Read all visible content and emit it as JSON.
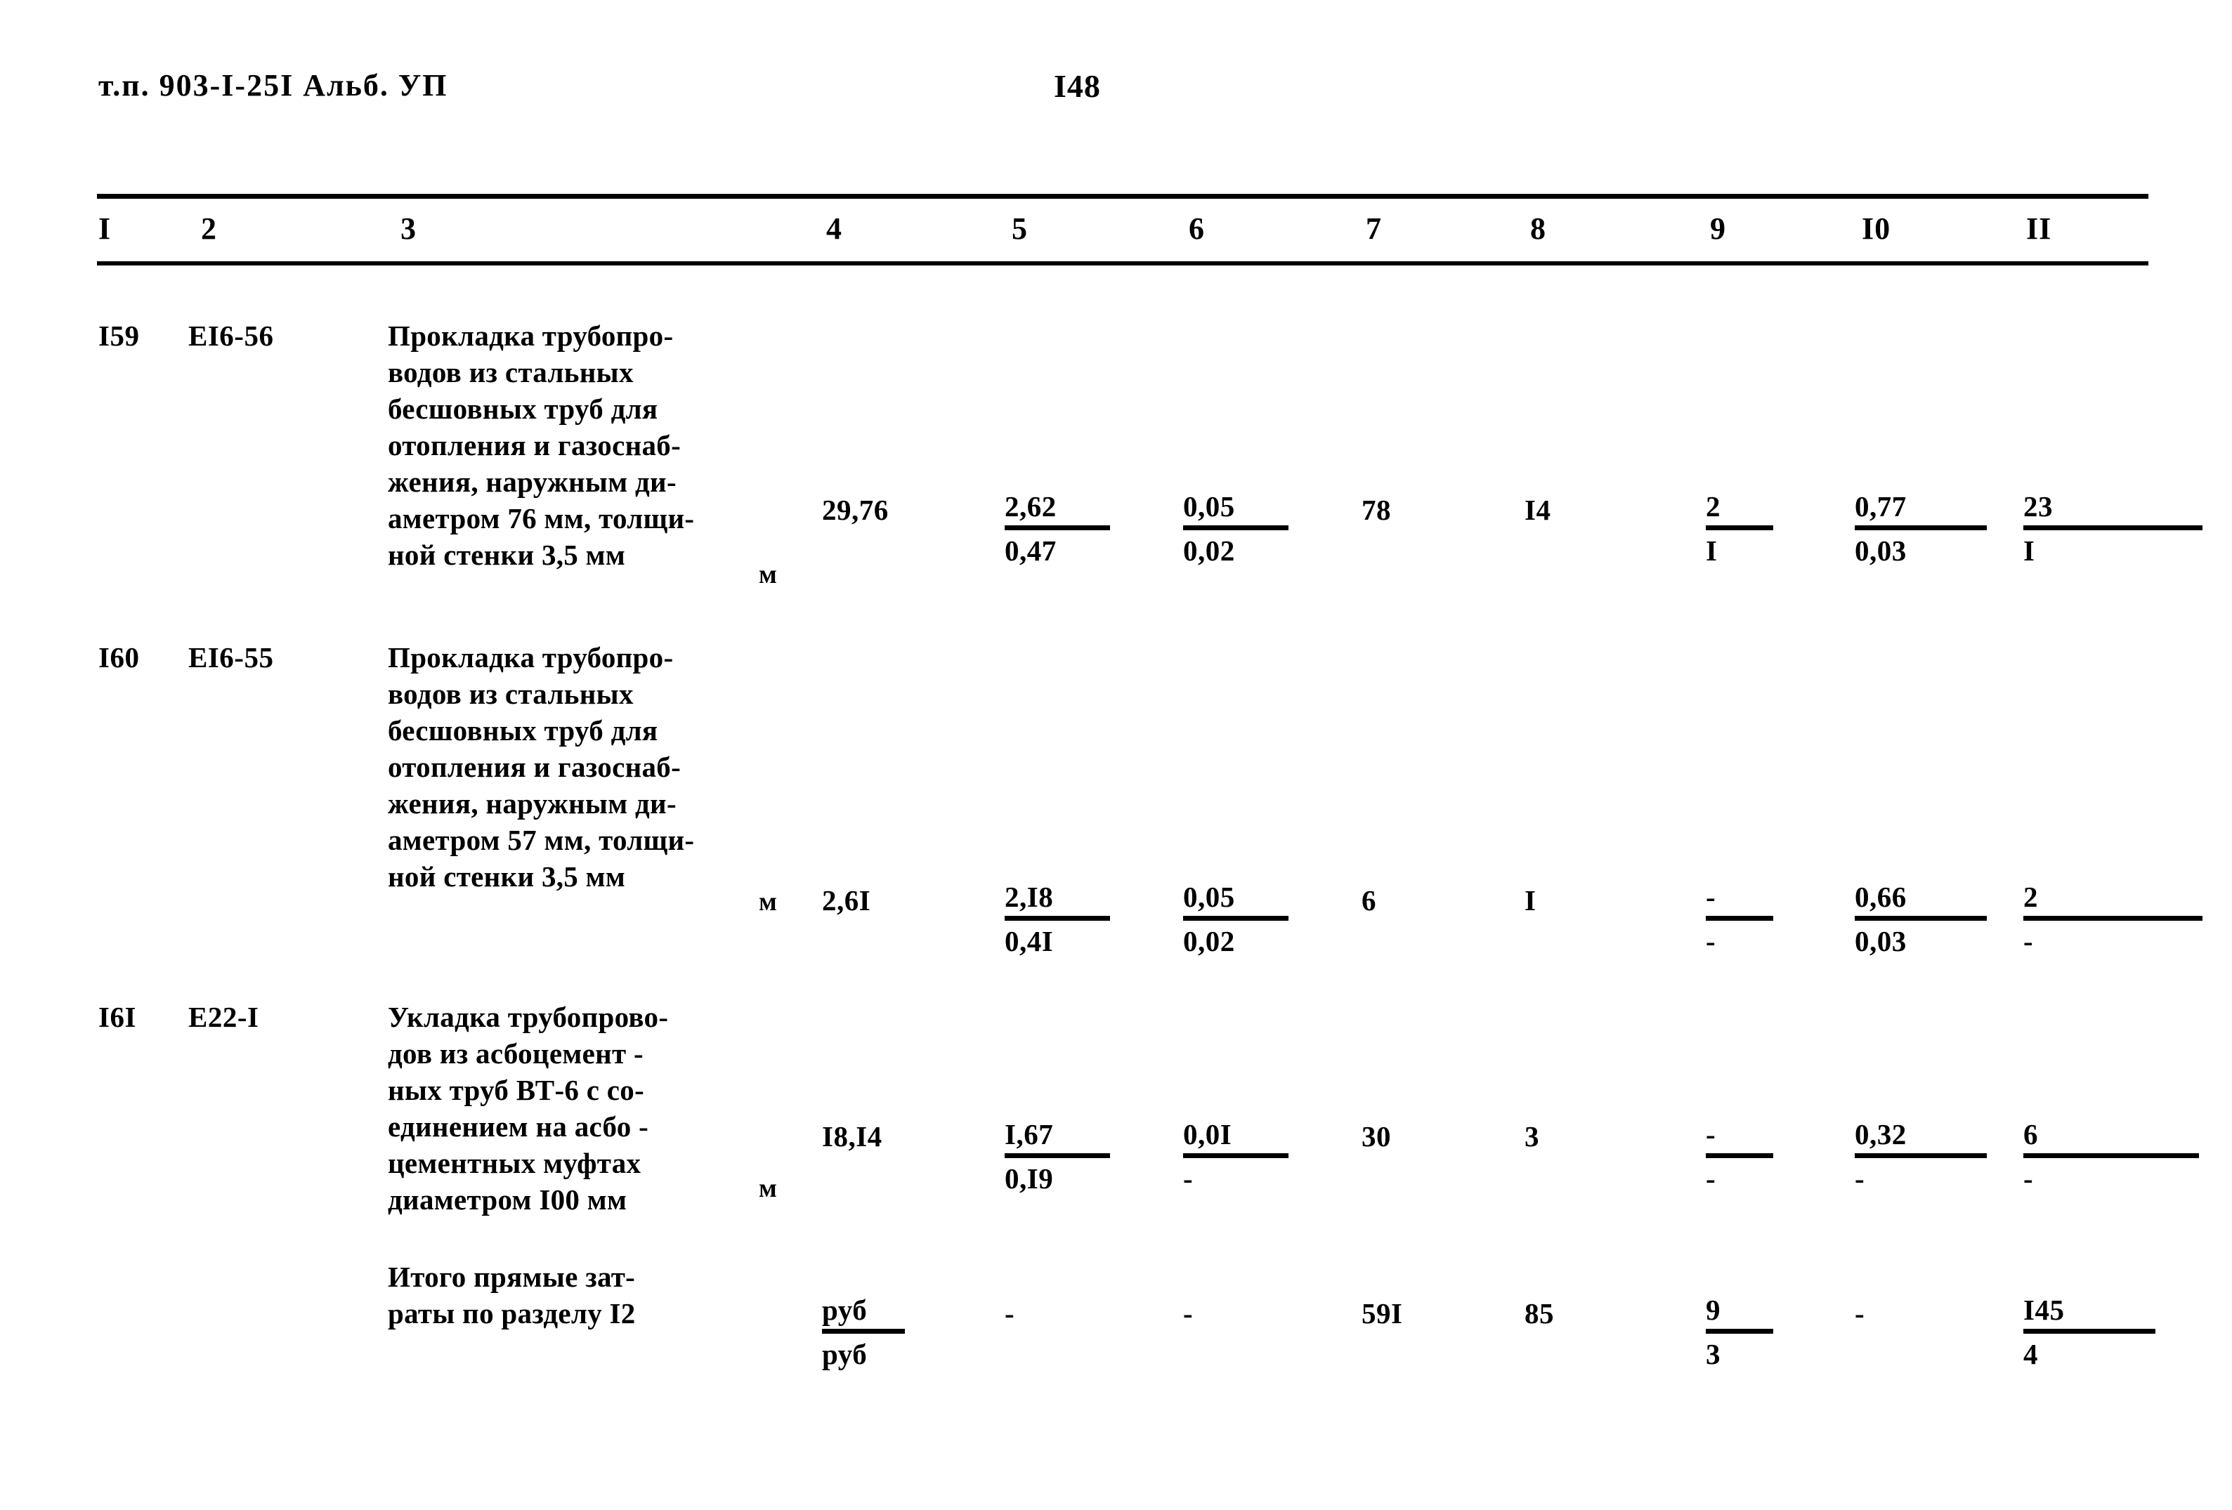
{
  "header": {
    "doc_code": "т.п. 903-I-25I Альб. УП",
    "page_number": "I48"
  },
  "table": {
    "column_numbers": [
      "I",
      "2",
      "3",
      "4",
      "5",
      "6",
      "7",
      "8",
      "9",
      "I0",
      "II"
    ],
    "rows": [
      {
        "num": "I59",
        "code": "EI6-56",
        "description": "Прокладка трубопро-\nводов из стальных\nбесшовных труб для\nотопления и газоснаб-\nжения, наружным ди-\nаметром 76 мм, толщи-\nной стенки 3,5 мм",
        "unit": "м",
        "c4": "29,76",
        "c5_top": "2,62",
        "c5_bot": "0,47",
        "c6_top": "0,05",
        "c6_bot": "0,02",
        "c7": "78",
        "c8": "I4",
        "c9_top": "2",
        "c9_bot": "I",
        "c10_top": "0,77",
        "c10_bot": "0,03",
        "c11_top": "23",
        "c11_bot": "I"
      },
      {
        "num": "I60",
        "code": "EI6-55",
        "description": "Прокладка трубопро-\nводов из стальных\nбесшовных труб для\nотопления и газоснаб-\nжения, наружным ди-\nаметром 57 мм, толщи-\nной стенки 3,5 мм",
        "unit": "м",
        "c4": "2,6I",
        "c5_top": "2,I8",
        "c5_bot": "0,4I",
        "c6_top": "0,05",
        "c6_bot": "0,02",
        "c7": "6",
        "c8": "I",
        "c9_top": "-",
        "c9_bot": "-",
        "c10_top": "0,66",
        "c10_bot": "0,03",
        "c11_top": "2",
        "c11_bot": "-"
      },
      {
        "num": "I6I",
        "code": "E22-I",
        "description": "Укладка трубопрово-\nдов из асбоцемент -\nных труб ВТ-6 с со-\nединением на асбо -\nцементных муфтах\nдиаметром I00 мм",
        "unit": "м",
        "c4": "I8,I4",
        "c5_top": "I,67",
        "c5_bot": "0,I9",
        "c6_top": "0,0I",
        "c6_bot": "-",
        "c7": "30",
        "c8": "3",
        "c9_top": "-",
        "c9_bot": "-",
        "c10_top": "0,32",
        "c10_bot": "-",
        "c11_top": "6",
        "c11_bot": "-"
      }
    ],
    "totals": {
      "description": "Итого прямые  зат-\nраты по разделу I2",
      "c4_top": "руб",
      "c4_bot": "руб",
      "c5": "-",
      "c6": "-",
      "c7": "59I",
      "c8": "85",
      "c9_top": "9",
      "c9_bot": "3",
      "c10": "-",
      "c11_top": "I45",
      "c11_bot": "4"
    }
  }
}
